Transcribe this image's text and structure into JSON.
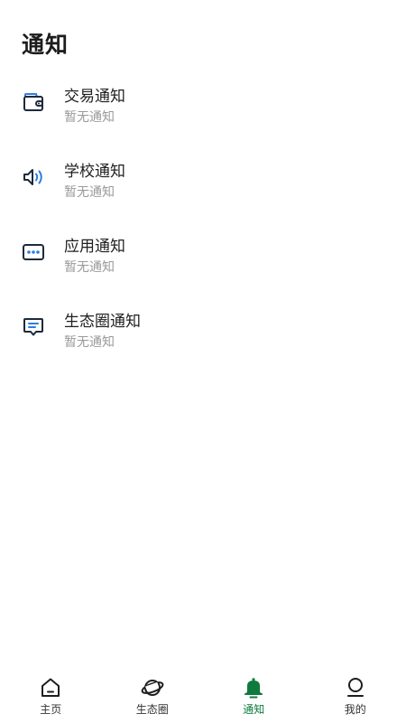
{
  "header": {
    "title": "通知"
  },
  "notices": [
    {
      "title": "交易通知",
      "subtitle": "暂无通知",
      "icon": "wallet-icon"
    },
    {
      "title": "学校通知",
      "subtitle": "暂无通知",
      "icon": "speaker-icon"
    },
    {
      "title": "应用通知",
      "subtitle": "暂无通知",
      "icon": "app-dots-icon"
    },
    {
      "title": "生态圈通知",
      "subtitle": "暂无通知",
      "icon": "message-icon"
    }
  ],
  "tabbar": {
    "items": [
      {
        "label": "主页",
        "icon": "home-icon"
      },
      {
        "label": "生态圈",
        "icon": "planet-icon"
      },
      {
        "label": "通知",
        "icon": "bell-icon",
        "active": true
      },
      {
        "label": "我的",
        "icon": "user-icon"
      }
    ]
  },
  "colors": {
    "accent": "#0f7a3d",
    "icon_dark": "#1e2a3a",
    "icon_blue": "#2f7de0",
    "subtitle": "#9a9a9a"
  }
}
